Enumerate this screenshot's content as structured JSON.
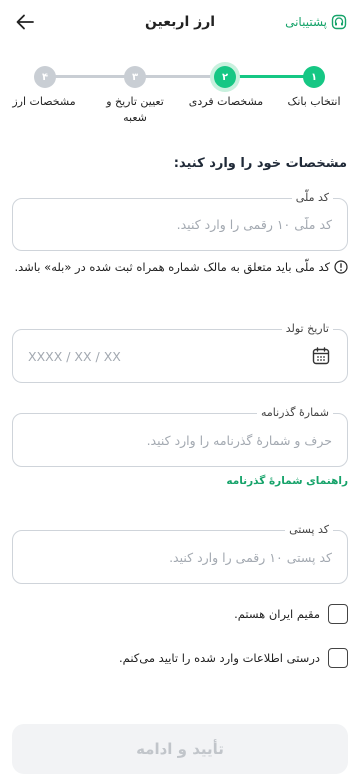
{
  "header": {
    "title": "ارز اربعین",
    "support_label": "پشتیبانی",
    "back_icon": "arrow-left-icon",
    "support_icon": "headset-icon"
  },
  "stepper": {
    "active_color": "#16c784",
    "inactive_color": "#c9ced4",
    "steps": [
      {
        "number": "۱",
        "label": "انتخاب بانک",
        "state": "completed"
      },
      {
        "number": "۲",
        "label": "مشخصات فردی",
        "state": "active"
      },
      {
        "number": "۳",
        "label": "تعیین تاریخ و شعبه",
        "state": "pending"
      },
      {
        "number": "۴",
        "label": "مشخصات ارز",
        "state": "pending"
      }
    ]
  },
  "form": {
    "section_title": "مشخصات خود را وارد کنید:",
    "national_code": {
      "label": "کد ملّی",
      "placeholder": "کد ملّی ۱۰ رقمی را وارد کنید.",
      "note": "کد ملّی باید متعلق به مالک شماره همراه ثبت شده در «بله» باشد.",
      "note_icon": "info-icon"
    },
    "birth_date": {
      "label": "تاریخ تولد",
      "placeholder": "XXXX / XX / XX",
      "icon": "calendar-icon"
    },
    "passport": {
      "label": "شمارهٔ گذرنامه",
      "placeholder": "حرف و شمارهٔ گذرنامه را وارد کنید.",
      "help_link": "راهنمای شمارهٔ گذرنامه"
    },
    "postal_code": {
      "label": "کد پستی",
      "placeholder": "کد پستی ۱۰ رقمی را وارد کنید."
    },
    "checkboxes": [
      {
        "label": "مقیم ایران هستم.",
        "checked": false
      },
      {
        "label": "درستی اطلاعات وارد شده را تایید می‌کنم.",
        "checked": false
      }
    ],
    "submit_label": "تأیید و ادامه"
  },
  "colors": {
    "accent": "#16a36a",
    "border": "#cfd4da",
    "disabled_bg": "#f2f3f5",
    "disabled_text": "#c1c5ca"
  }
}
